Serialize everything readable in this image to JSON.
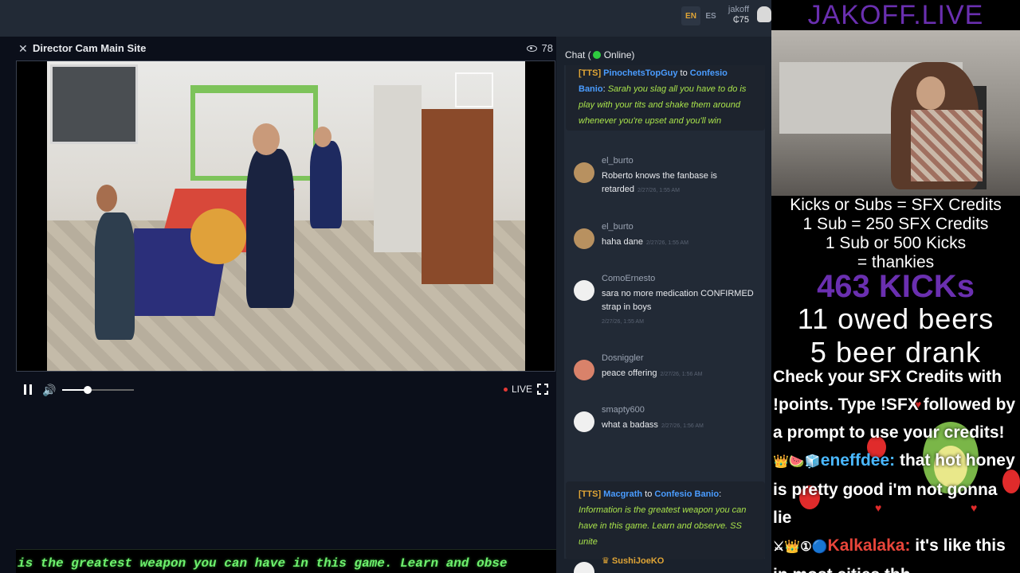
{
  "topbar": {
    "lang_en": "EN",
    "lang_es": "ES",
    "username": "jakoff",
    "balance": "₵75"
  },
  "video": {
    "title": "Director Cam Main Site",
    "viewer_count": "78",
    "live_label": "LIVE",
    "volume_fraction": 0.35,
    "ticker": "is the greatest weapon you can have in this game. Learn and obse"
  },
  "chat": {
    "header_label": "Chat (",
    "status": "Online)",
    "tts_messages": [
      {
        "tag": "[TTS]",
        "user": "PinochetsTopGuy",
        "to": "to",
        "recipient": "Confesio Banio",
        "body": "Sarah you slag all you have to do is play with your tits and shake them around whenever you're upset and you'll win"
      },
      {
        "tag": "[TTS]",
        "user": "Macgrath",
        "to": "to",
        "recipient": "Confesio Banio",
        "body": "Information is the greatest weapon you can have in this game. Learn and observe. SS unite"
      }
    ],
    "messages": [
      {
        "user": "el_burto",
        "text": "Roberto knows the fanbase is retarded",
        "time": "2/27/26, 1:55 AM",
        "avatar": "owl-avatar-icon"
      },
      {
        "user": "el_burto",
        "text": "haha dane",
        "time": "2/27/26, 1:55 AM",
        "avatar": "owl-avatar-icon"
      },
      {
        "user": "ComoErnesto",
        "text": "sara no more medication CONFIRMED strap in boys",
        "time": "2/27/26, 1:55 AM",
        "avatar": "ghost-avatar-icon"
      },
      {
        "user": "Dosniggler",
        "text": "peace offering",
        "time": "2/27/26, 1:56 AM",
        "avatar": "face-avatar-icon"
      },
      {
        "user": "smapty600",
        "text": "what a badass",
        "time": "2/27/26, 1:56 AM",
        "avatar": "ghost-avatar-icon"
      },
      {
        "user": "SushiJoeKO",
        "text": "",
        "time": "",
        "avatar": "ghost-avatar-icon"
      }
    ]
  },
  "overlay": {
    "brand": "JAKOFF.LIVE",
    "info_lines": [
      "Kicks or Subs = SFX Credits",
      "1 Sub = 250 SFX Credits",
      "1 Sub or 500 Kicks",
      "= thankies"
    ],
    "kicks": "463 KICKs",
    "owed_beers": "11 owed beers",
    "beers_drank": "5 beer drank",
    "alert_intro": "Check your SFX Credits with !points. Type !SFX followed by a prompt to use your credits!",
    "chat1_user": "eneffdee:",
    "chat1_text": "that hot honey is pretty good i'm not gonna lie",
    "chat2_user": "Kalkalaka:",
    "chat2_text": "it's like this in most cities tbh"
  },
  "colors": {
    "accent_gold": "#e0a536",
    "tts_body": "#a9e34b",
    "user_link": "#4a9cff",
    "brand_purple": "#6a2fb0",
    "ticker_green": "#6ef06e",
    "online": "#2ecc40"
  }
}
